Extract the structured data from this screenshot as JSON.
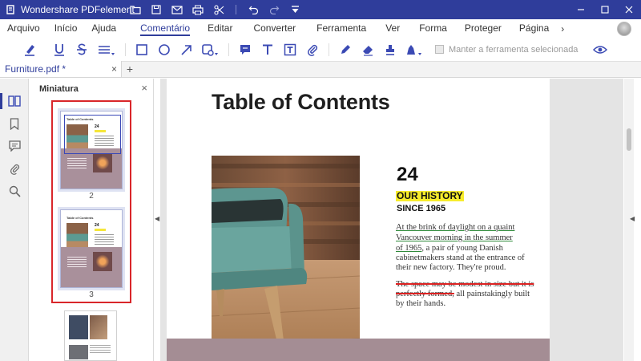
{
  "window": {
    "app_title": "Wondershare PDFelement"
  },
  "menu": {
    "items": [
      "Arquivo",
      "Início",
      "Ajuda",
      "Comentário",
      "Editar",
      "Converter",
      "Ferramenta",
      "Ver",
      "Forma",
      "Proteger",
      "Página"
    ],
    "active": "Comentário",
    "more_glyph": "›"
  },
  "toolbar": {
    "keep_tool_label": "Manter a ferramenta selecionada",
    "keep_tool_checked": false,
    "accent_color": "#2f3d9b"
  },
  "tabs": {
    "doc_tab_label": "Furniture.pdf *",
    "close_glyph": "×",
    "add_glyph": "+"
  },
  "thumbnail_panel": {
    "title": "Miniatura",
    "close_glyph": "×",
    "page_labels": [
      "2",
      "3"
    ],
    "thumb_heading": "Table of Contents",
    "thumb_number": "24"
  },
  "document": {
    "title": "Table of Contents",
    "number": "24",
    "history": "OUR HISTORY",
    "since": "SINCE 1965",
    "para1": {
      "line1": "At the brink of daylight on a quaint",
      "line2": "Vancouver morning in the summer",
      "line3_underlined": "of 1965",
      "line3_rest": ", a pair of young Danish",
      "line4": "cabinetmakers stand at the entrance of",
      "line5": "their new factory. They're proud."
    },
    "para2": {
      "line1_struck": "The space may be modest in size but it is",
      "line2_struck": "perfectly formed,",
      "line2_rest": " all painstakingly built",
      "line3": "by their hands."
    },
    "highlight_color": "#f7ec2c",
    "strike_color": "#d22222",
    "underline_color": "#2f8a3a"
  }
}
